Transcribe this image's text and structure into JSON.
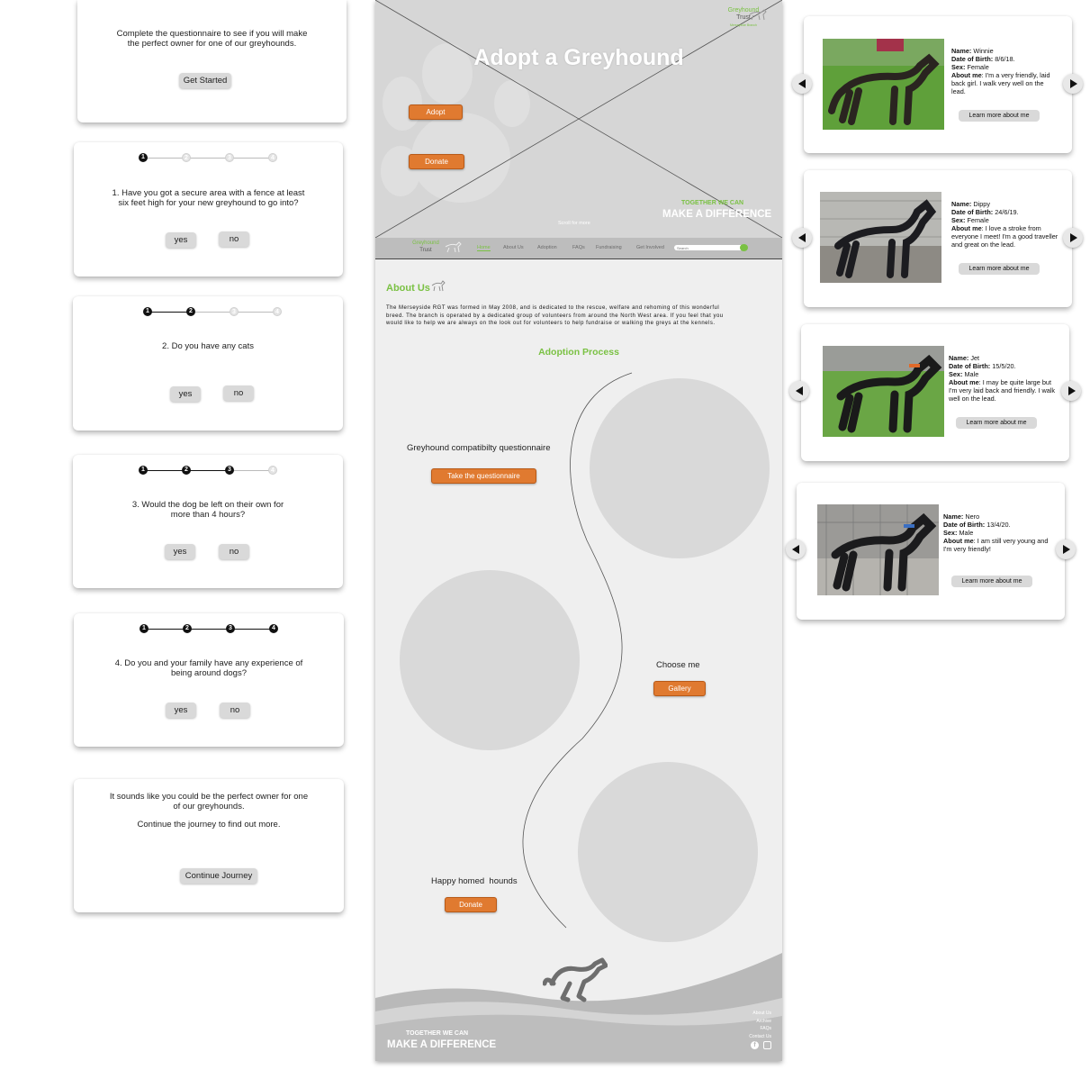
{
  "intro": {
    "text": "Complete the questionnaire to see if you will make the perfect owner for one of our greyhounds.",
    "button": "Get Started"
  },
  "questions": [
    {
      "text": "1. Have you got a secure area with a fence at least six feet high for your new greyhound to go into?",
      "yes": "yes",
      "no": "no",
      "steps": [
        "1",
        "2",
        "3",
        "4"
      ],
      "current": 1
    },
    {
      "text": "2. Do you have any cats",
      "yes": "yes",
      "no": "no",
      "steps": [
        "1",
        "2",
        "3",
        "4"
      ],
      "current": 2
    },
    {
      "text": "3. Would the dog be left on their own for more than 4 hours?",
      "yes": "yes",
      "no": "no",
      "steps": [
        "1",
        "2",
        "3",
        "4"
      ],
      "current": 3
    },
    {
      "text": "4. Do you and your family have any experience of being around dogs?",
      "yes": "yes",
      "no": "no",
      "steps": [
        "1",
        "2",
        "3",
        "4"
      ],
      "current": 4
    }
  ],
  "result": {
    "line1": "It sounds like you could be the perfect owner for one of our greyhounds.",
    "line2": "Continue the journey to find out more.",
    "button": "Continue Journey"
  },
  "hero": {
    "logo_line1": "Greyhound",
    "logo_line2": "Trust",
    "logo_line3": "Merseyside Branch",
    "title": "Adopt a Greyhound",
    "adopt_button": "Adopt",
    "donate_button": "Donate",
    "tagline_small": "TOGETHER WE CAN",
    "tagline_big": "MAKE A DIFFERENCE",
    "scroll": "Scroll for more"
  },
  "nav": {
    "logo_line1": "Greyhound",
    "logo_line2": "Trust",
    "items": [
      "Home",
      "About Us",
      "Adoption",
      "FAQs",
      "Fundraising",
      "Get Involved"
    ],
    "search_placeholder": "Search"
  },
  "about": {
    "title": "About Us",
    "body": "The Merseyside RGT was formed in May 2008, and is dedicated to the rescue, welfare and rehoming of this wonderful breed. The branch is operated by a dedicated group of volunteers from around the North West area. If you feel that you would like to help we are always on the look out for volunteers to help fundraise or walking the greys at the kennels."
  },
  "process": {
    "title": "Adoption Process",
    "step1_label": "Greyhound compatibilty questionnaire",
    "step1_button": "Take the questionnaire",
    "step2_label": "Choose me",
    "step2_button": "Gallery",
    "step3_label": "Happy homed  hounds",
    "step3_button": "Donate"
  },
  "footer": {
    "links": [
      "About Us",
      "Archive",
      "FAQs",
      "Contact Us"
    ],
    "tagline_small": "TOGETHER WE CAN",
    "tagline_big": "MAKE A DIFFERENCE"
  },
  "labels": {
    "name": "Name:",
    "dob": "Date of Birth:",
    "sex": "Sex:",
    "about": "About me"
  },
  "dogs": [
    {
      "name": "Winnie",
      "dob": "8/6/18.",
      "sex": "Female",
      "about": ": I'm a very friendly, laid back girl. I walk very well on the lead.",
      "button": "Learn more about me"
    },
    {
      "name": "Dippy",
      "dob": "24/6/19.",
      "sex": "Female",
      "about": ": I love a stroke from everyone I meet! I'm a good traveller and great on the lead.",
      "button": "Learn more about me"
    },
    {
      "name": "Jet",
      "dob": "15/5/20.",
      "sex": "Male",
      "about": ": I may be quite large but I'm very laid back and friendly. I walk well on the lead.",
      "button": "Learn more about me"
    },
    {
      "name": "Nero",
      "dob": "13/4/20.",
      "sex": "Male",
      "about": ": I am still very young and I'm very friendly!",
      "button": "Learn more about me"
    }
  ],
  "colors": {
    "accent_orange": "#e07a30",
    "brand_green": "#7ac143",
    "wireframe_grey": "#d9d9d9"
  }
}
